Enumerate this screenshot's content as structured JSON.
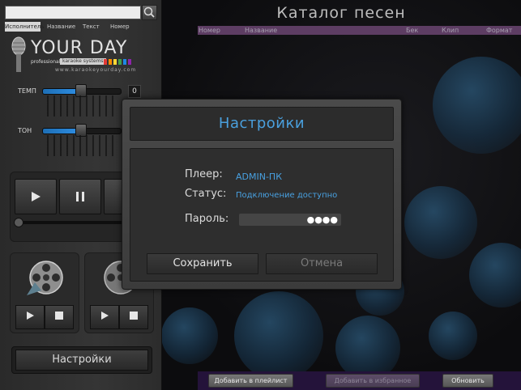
{
  "search": {
    "value": ""
  },
  "filters": [
    "Исполнитель",
    "Название",
    "Текст",
    "Номер"
  ],
  "filters_active_index": 0,
  "logo": {
    "name": "YOUR DAY",
    "sub_prefix": "professional",
    "sub_badge": "karaoke systems",
    "url": "www.karaokeyourday.com"
  },
  "tempo": {
    "label": "ТЕМП",
    "value": "0"
  },
  "tone": {
    "label": "ТОН"
  },
  "player": {
    "play_icon": "play-icon",
    "pause_icon": "pause-icon",
    "stop_icon": "stop-icon"
  },
  "left_settings_button": "Настройки",
  "catalog": {
    "title": "Каталог песен",
    "columns": [
      "Номер",
      "Название",
      "Бек",
      "Клип",
      "Формат"
    ],
    "bottom_buttons": [
      "Добавить в плейлист",
      "Добавить в избранное",
      "Обновить"
    ],
    "bottom_disabled": [
      false,
      true,
      false
    ]
  },
  "modal": {
    "title": "Настройки",
    "player_label": "Плеер:",
    "player_value": "ADMIN-ПК",
    "status_label": "Статус:",
    "status_value": "Подключение доступно",
    "password_label": "Пароль:",
    "password_value": "●●●●",
    "save_button": "Сохранить",
    "cancel_button": "Отмена"
  },
  "colors": {
    "accent": "#4aa0de",
    "catalog_header": "#5d3d63",
    "bottom_bar": "#24133a"
  }
}
